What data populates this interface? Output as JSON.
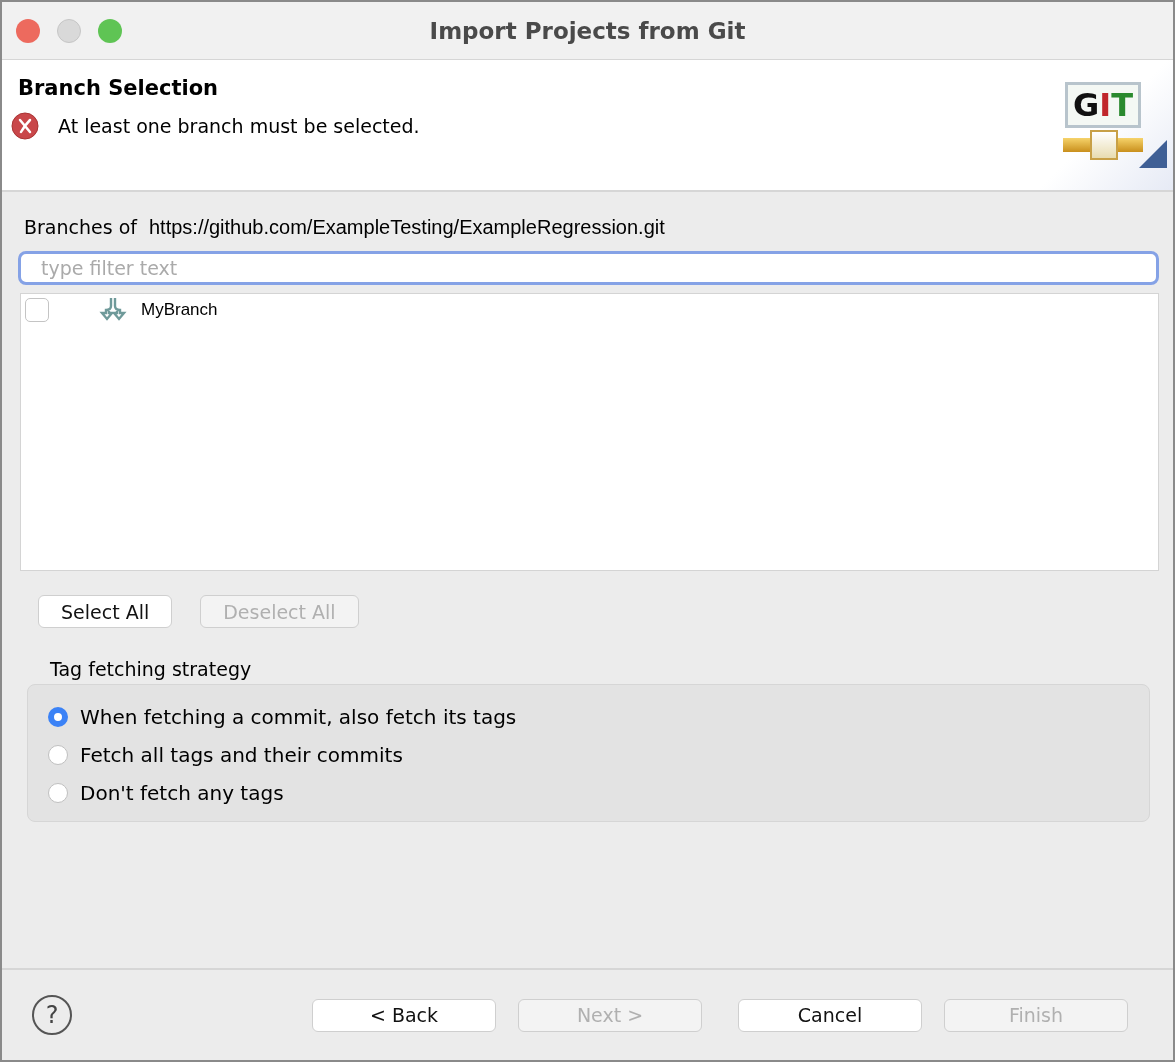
{
  "window": {
    "title": "Import Projects from Git"
  },
  "header": {
    "title": "Branch Selection",
    "message": "At least one branch must be selected.",
    "error": true,
    "logo": "GIT"
  },
  "branches": {
    "label": "Branches of",
    "url": "https://github.com/ExampleTesting/ExampleRegression.git",
    "filter": {
      "placeholder": "type filter text"
    },
    "items": [
      {
        "name": "MyBranch",
        "checked": false
      }
    ]
  },
  "selection_buttons": [
    {
      "label": "Select All",
      "disabled": false
    },
    {
      "label": "Deselect All",
      "disabled": true
    }
  ],
  "tag_strategy": {
    "title": "Tag fetching strategy",
    "options": [
      {
        "label": "When fetching a commit, also fetch its tags",
        "selected": true
      },
      {
        "label": "Fetch all tags and their commits",
        "selected": false
      },
      {
        "label": "Don't fetch any tags",
        "selected": false
      }
    ]
  },
  "footer": {
    "help": "?",
    "buttons": [
      {
        "label": "< Back",
        "disabled": false
      },
      {
        "label": "Next >",
        "disabled": true
      },
      {
        "label": "Cancel",
        "disabled": false
      },
      {
        "label": "Finish",
        "disabled": true
      }
    ]
  }
}
